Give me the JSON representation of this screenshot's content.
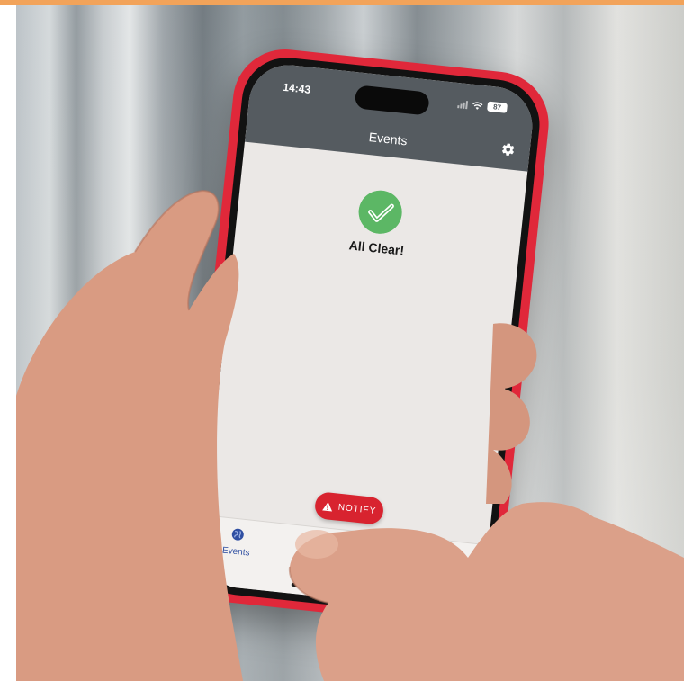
{
  "status_bar": {
    "time": "14:43",
    "battery": "87"
  },
  "header": {
    "title": "Events",
    "settings_icon": "gear-icon"
  },
  "main": {
    "status_icon": "check-circle-icon",
    "status_text": "All Clear!",
    "status_color": "#5cb765"
  },
  "actions": {
    "notify_label": "NOTIFY",
    "notify_icon": "warning-triangle-icon",
    "notify_color": "#d8232f"
  },
  "tab_bar": {
    "tabs": [
      {
        "label": "Events",
        "icon": "globe-icon",
        "active": true
      }
    ]
  },
  "colors": {
    "header_bg": "#555b60",
    "case": "#e0283a",
    "screen_bg": "#ebe8e6",
    "accent_stripe": "#f2a35a"
  }
}
